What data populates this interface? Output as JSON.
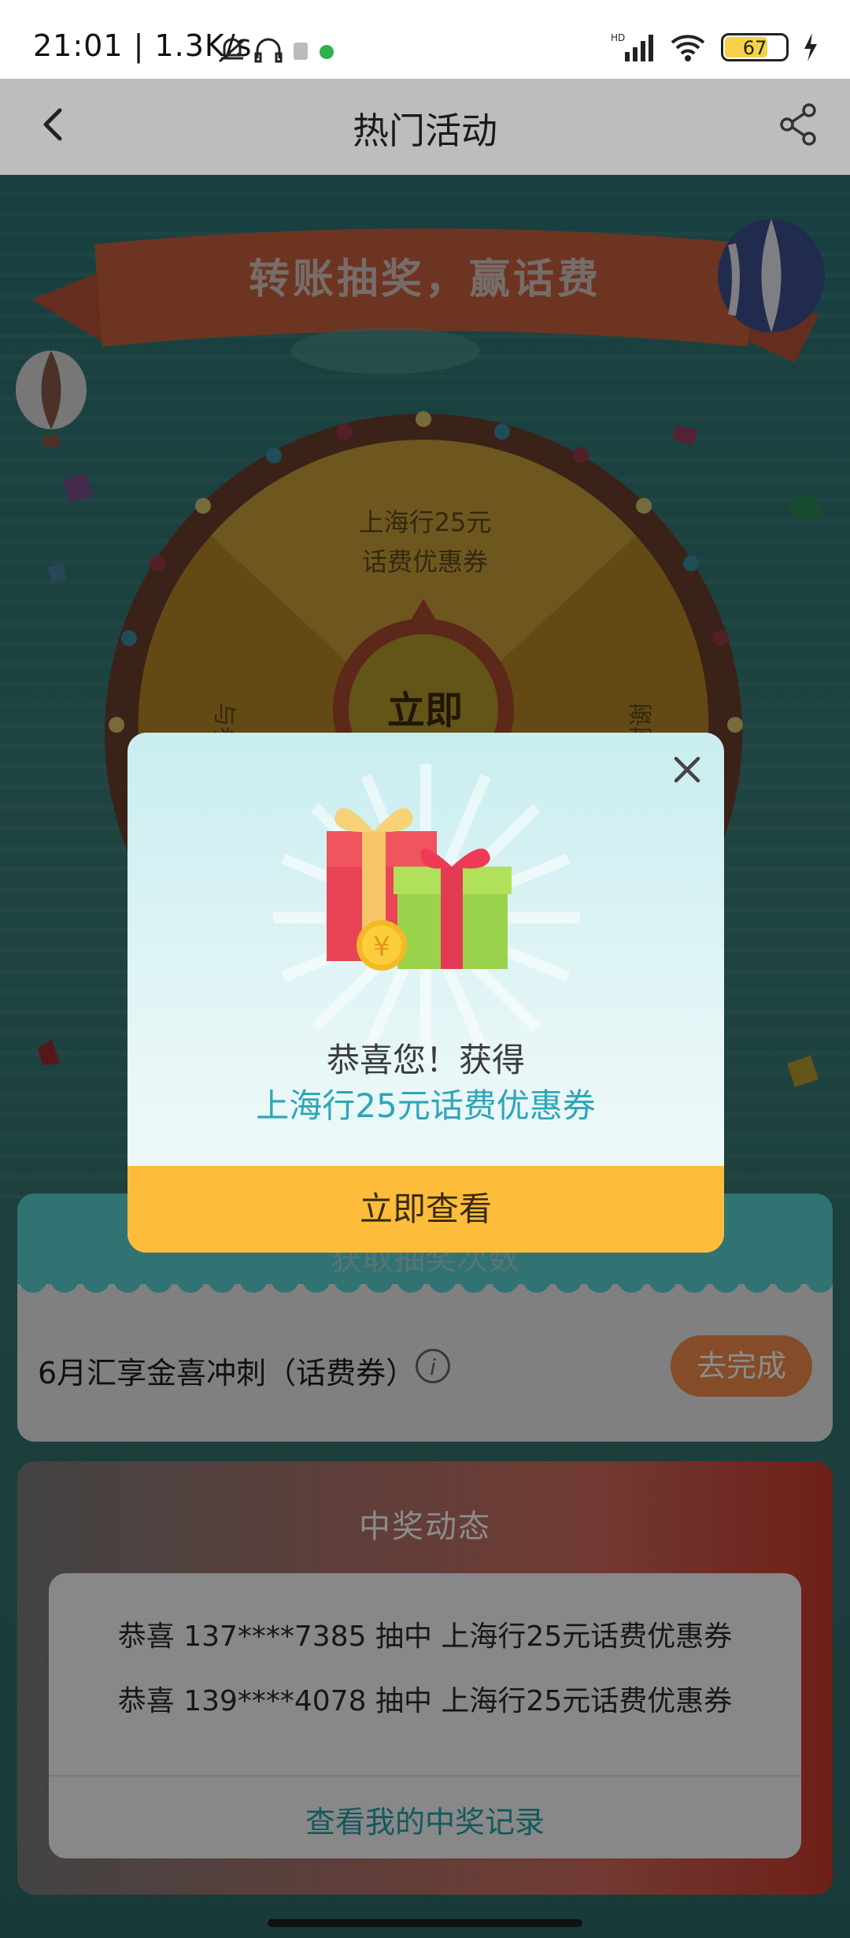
{
  "status_bar": {
    "time_speed": "21:01 | 1.3K/s",
    "battery": "67"
  },
  "header": {
    "title": "热门活动"
  },
  "banner": {
    "title": "转账抽奖，赢话费"
  },
  "wheel": {
    "top_prize_line1": "上海行25元",
    "top_prize_line2": "话费优惠券",
    "left_label": "与参",
    "right_label": "谢谢",
    "center_button": "立即"
  },
  "task_card": {
    "header_text": "获取抽奖次数",
    "task_label": "6月汇享金喜冲刺（话费券）",
    "info_icon_text": "i",
    "action_label": "去完成"
  },
  "winners": {
    "title": "中奖动态",
    "items": [
      "恭喜 137****7385 抽中 上海行25元话费优惠券",
      "恭喜 139****4078 抽中 上海行25元话费优惠券"
    ],
    "link": "查看我的中奖记录"
  },
  "modal": {
    "congrats": "恭喜您！获得",
    "prize": "上海行25元话费优惠券",
    "button": "立即查看",
    "coin_symbol": "¥"
  },
  "colors": {
    "accent_teal": "#2ea5b8",
    "button_yellow": "#fdbd3b",
    "goto_orange": "#f08a4a"
  }
}
